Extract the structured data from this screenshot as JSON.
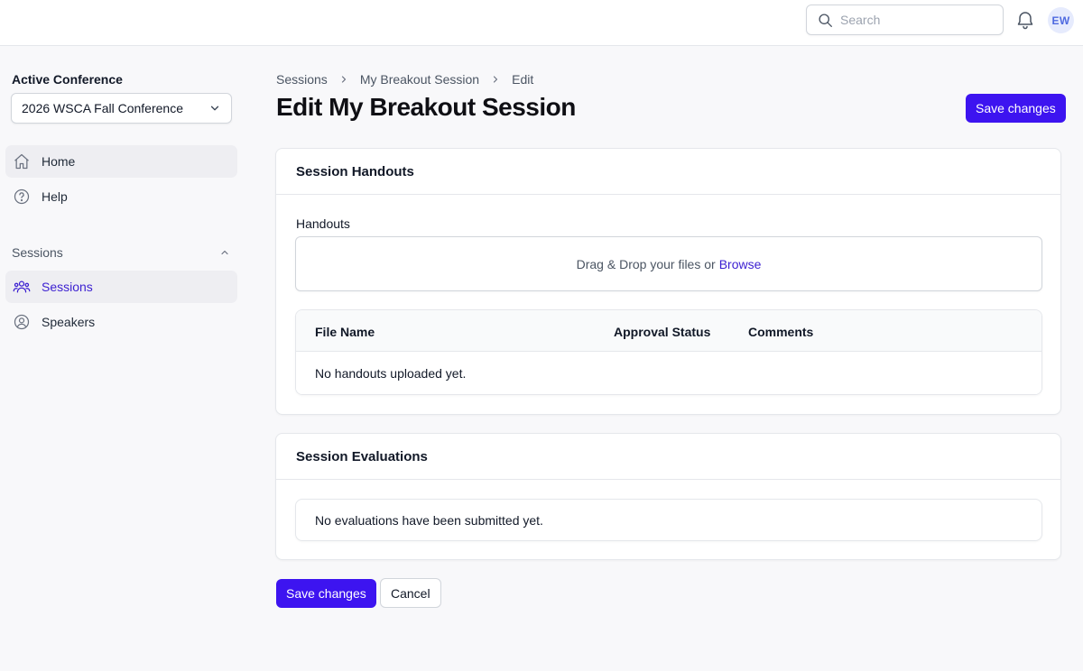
{
  "header": {
    "search_placeholder": "Search",
    "avatar_initials": "EW"
  },
  "sidebar": {
    "conference_label": "Active Conference",
    "conference_selected": "2026 WSCA Fall Conference",
    "nav": [
      {
        "label": "Home",
        "icon": "home-icon"
      },
      {
        "label": "Help",
        "icon": "help-icon"
      }
    ],
    "section": {
      "title": "Sessions",
      "items": [
        {
          "label": "Sessions",
          "icon": "users-icon"
        },
        {
          "label": "Speakers",
          "icon": "user-circle-icon"
        }
      ]
    }
  },
  "breadcrumb": [
    "Sessions",
    "My Breakout Session",
    "Edit"
  ],
  "page": {
    "title": "Edit My Breakout Session",
    "save_label": "Save changes",
    "cancel_label": "Cancel"
  },
  "handouts_card": {
    "title": "Session Handouts",
    "field_label": "Handouts",
    "drop_text": "Drag & Drop your files or",
    "browse_text": "Browse",
    "columns": [
      "File Name",
      "Approval Status",
      "Comments"
    ],
    "empty_text": "No handouts uploaded yet."
  },
  "evaluations_card": {
    "title": "Session Evaluations",
    "empty_text": "No evaluations have been submitted yet."
  },
  "colors": {
    "accent": "#3d14f0",
    "link": "#3b1fd1",
    "avatar_bg": "#e6ebfd"
  }
}
